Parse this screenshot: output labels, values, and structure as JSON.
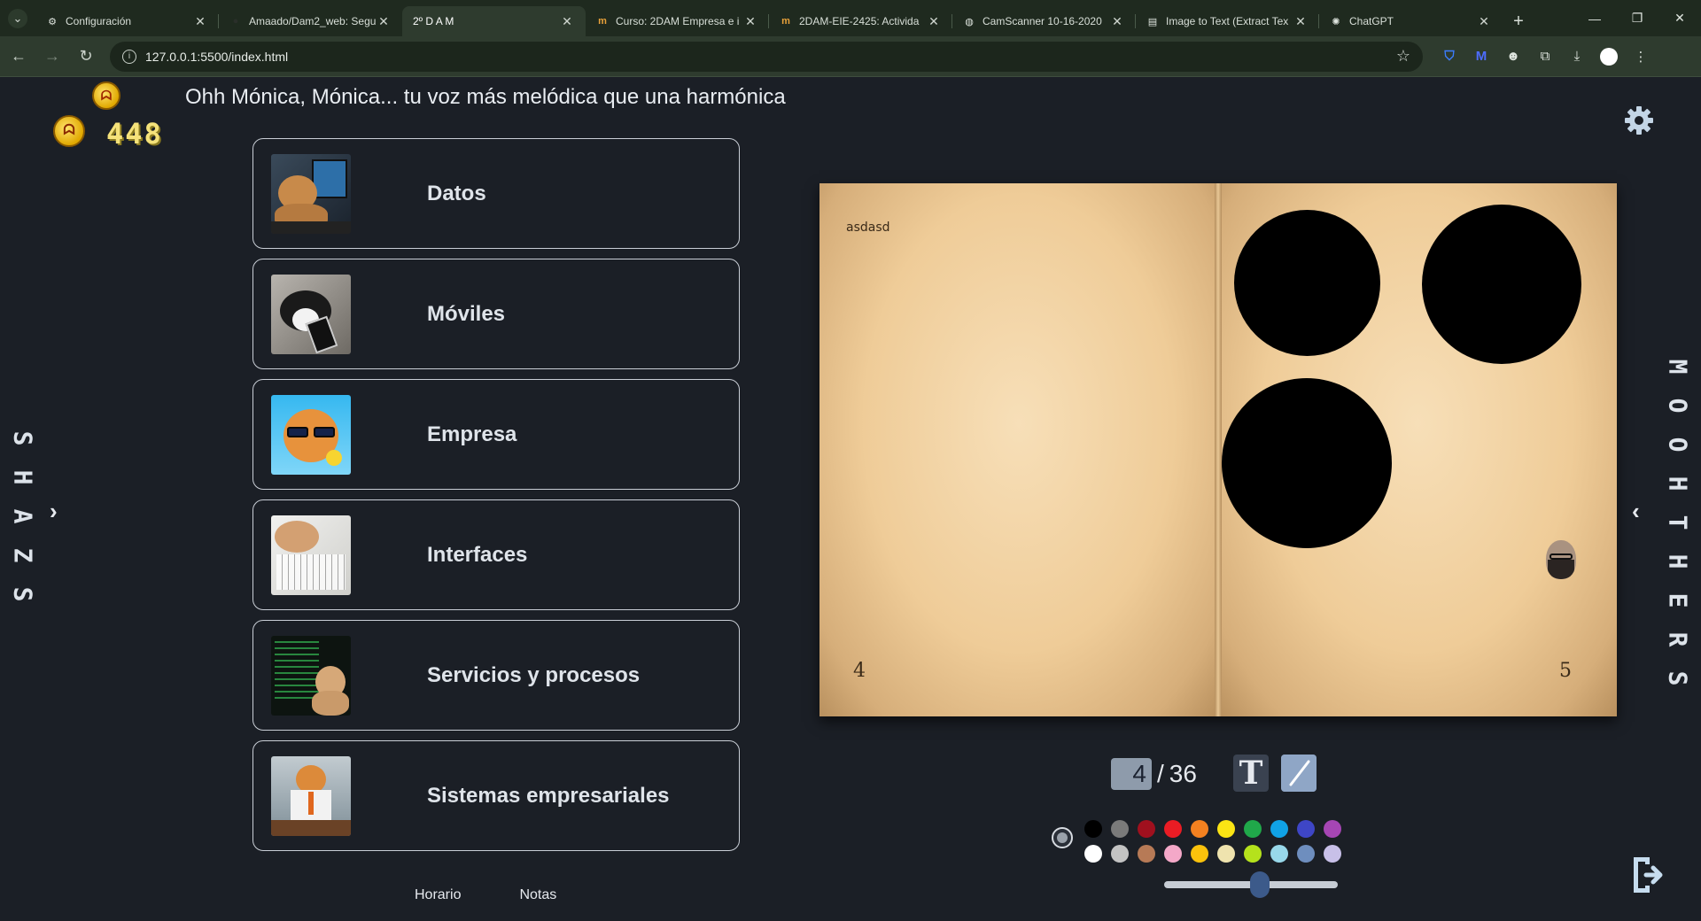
{
  "browser": {
    "tabs": [
      {
        "title": "Configuración",
        "icon": "gear-icon",
        "active": false
      },
      {
        "title": "Amaado/Dam2_web: Segu",
        "icon": "github-icon",
        "active": false
      },
      {
        "title": "2º D A M",
        "icon": "",
        "active": true
      },
      {
        "title": "Curso: 2DAM Empresa e i",
        "icon": "moodle-icon",
        "active": false
      },
      {
        "title": "2DAM-EIE-2425: Activida",
        "icon": "moodle-icon",
        "active": false
      },
      {
        "title": "CamScanner 10-16-2020",
        "icon": "globe-icon",
        "active": false
      },
      {
        "title": "Image to Text (Extract Tex",
        "icon": "doc-icon",
        "active": false
      },
      {
        "title": "ChatGPT",
        "icon": "chatgpt-icon",
        "active": false
      }
    ],
    "url": "127.0.0.1:5500/index.html"
  },
  "header": {
    "quote": "Ohh Mónica, Mónica... tu voz más melódica que una harmónica",
    "coins": "448"
  },
  "side": {
    "left_text": "SHAZS",
    "right_text": "MOOHTHERS"
  },
  "subjects": [
    {
      "label": "Datos",
      "thumb": "cat-computer"
    },
    {
      "label": "Móviles",
      "thumb": "cat-phone"
    },
    {
      "label": "Empresa",
      "thumb": "cat-sunglasses"
    },
    {
      "label": "Interfaces",
      "thumb": "cat-sketch"
    },
    {
      "label": "Servicios y procesos",
      "thumb": "cat-code"
    },
    {
      "label": "Sistemas empresariales",
      "thumb": "cat-office"
    }
  ],
  "links": {
    "schedule": "Horario",
    "grades": "Notas"
  },
  "book": {
    "note": "asdasd",
    "left_page_number": "4",
    "right_page_number": "5"
  },
  "pager": {
    "current": "4",
    "separator": "/",
    "total": "36"
  },
  "tools": {
    "text_tool": "T"
  },
  "palette": {
    "row1": [
      "#000000",
      "#7a7a7a",
      "#a0101e",
      "#ea1c24",
      "#f48120",
      "#fbe414",
      "#20a84a",
      "#10a2e6",
      "#3e46c6",
      "#a646b4"
    ],
    "row2": [
      "#ffffff",
      "#c3c3c3",
      "#b77a56",
      "#f4a8c8",
      "#fbc20c",
      "#efe3ae",
      "#b5e21c",
      "#98d8ea",
      "#6e8ebe",
      "#c8c0e8"
    ]
  },
  "brush_size": 0.55
}
